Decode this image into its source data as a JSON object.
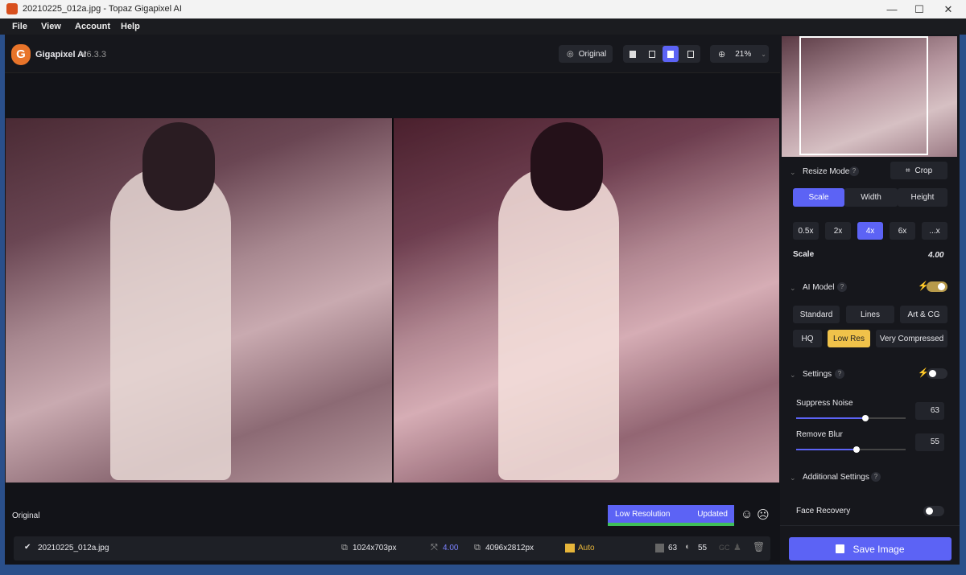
{
  "window": {
    "title": "20210225_012a.jpg - Topaz Gigapixel AI",
    "minimize": "—",
    "maximize": "☐",
    "close": "✕"
  },
  "menu": [
    "File",
    "View",
    "Account",
    "Help"
  ],
  "app": {
    "name": "Gigapixel AI",
    "version": "v6.3.3",
    "logo_letter": "G"
  },
  "toolbar": {
    "original_label": "Original",
    "zoom": "21%"
  },
  "preview": {
    "label": "Original",
    "status_left": "Low Resolution",
    "status_right": "Updated",
    "status_color": "#5c63f5"
  },
  "file": {
    "name": "20210225_012a.jpg",
    "input_size": "1024x703px",
    "scale": "4.00",
    "output_size": "4096x2812px",
    "auto": "Auto",
    "noise": "63",
    "blur": "55",
    "gc": "GC"
  },
  "panel": {
    "resize_mode": "Resize Mode",
    "crop": "Crop",
    "modes": [
      "Scale",
      "Width",
      "Height"
    ],
    "scales": [
      "0.5x",
      "2x",
      "4x",
      "6x",
      "...x"
    ],
    "scale_label": "Scale",
    "scale_value": "4.00",
    "ai_model": "AI Model",
    "models_row1": [
      "Standard",
      "Lines",
      "Art & CG"
    ],
    "models_row2": [
      "HQ",
      "Low Res",
      "Very Compressed"
    ],
    "settings": "Settings",
    "suppress_noise": "Suppress Noise",
    "suppress_noise_value": "63",
    "remove_blur": "Remove Blur",
    "remove_blur_value": "55",
    "additional": "Additional Settings",
    "face_recovery": "Face Recovery",
    "save": "Save Image",
    "help": "?"
  }
}
